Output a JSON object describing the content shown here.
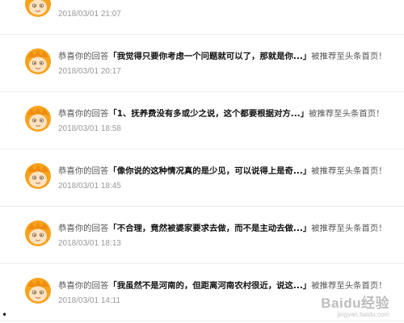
{
  "notifications": [
    {
      "prefix": "",
      "quote": "",
      "suffix": "",
      "time": "2018/03/01 21:07"
    },
    {
      "prefix": "恭喜你的回答",
      "quote": "「我觉得只要你考虑一个问题就可以了，那就是你...」",
      "suffix": "被推荐至头条首页！",
      "time": "2018/03/01 20:17"
    },
    {
      "prefix": "恭喜你的回答",
      "quote": "「1、抚养费没有多或少之说，这个都要根据对方...」",
      "suffix": "被推荐至头条首页！",
      "time": "2018/03/01 18:58"
    },
    {
      "prefix": "恭喜你的回答",
      "quote": "「像你说的这种情况真的是少见，可以说得上是奇...」",
      "suffix": "被推荐至头条首页！",
      "time": "2018/03/01 18:45"
    },
    {
      "prefix": "恭喜你的回答",
      "quote": "「不合理，竟然被婆家要求去做，而不是主动去做...」",
      "suffix": "被推荐至头条首页！",
      "time": "2018/03/01 18:13"
    },
    {
      "prefix": "恭喜你的回答",
      "quote": "「我虽然不是河南的，但距离河南农村很近，说这...」",
      "suffix": "被推荐至头条首页！",
      "time": "2018/03/01 14:11"
    }
  ],
  "bullet": "•",
  "watermark": {
    "main": "Baidu经验",
    "sub": "jingyan.baidu.com"
  },
  "colors": {
    "avatar_orange": "#f7a21b",
    "avatar_face": "#fde3c2",
    "text_dark": "#111111",
    "text_time": "#999999",
    "divider": "#eeeeee"
  }
}
